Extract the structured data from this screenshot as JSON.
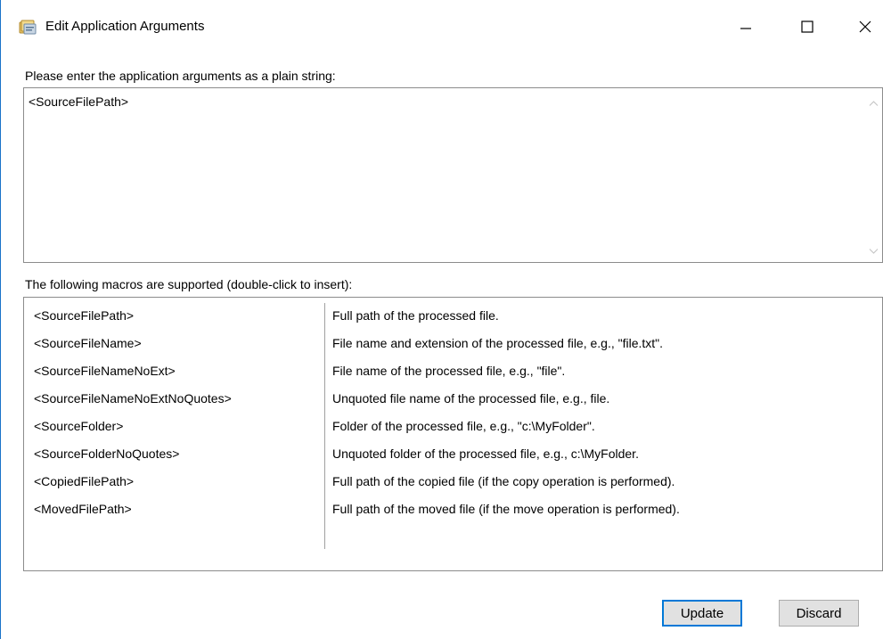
{
  "window": {
    "title": "Edit Application Arguments",
    "icon": "application-arguments-icon",
    "controls": [
      "minimize-icon",
      "maximize-icon",
      "close-icon"
    ]
  },
  "arguments": {
    "label": "Please enter the application arguments as a plain string:",
    "value": "<SourceFilePath>"
  },
  "macros": {
    "label": "The following macros are supported (double-click to insert):",
    "rows": [
      {
        "name": "<SourceFilePath>",
        "description": "Full path of the processed file."
      },
      {
        "name": "<SourceFileName>",
        "description": "File name and extension of the processed file, e.g., \"file.txt\"."
      },
      {
        "name": "<SourceFileNameNoExt>",
        "description": "File name of the processed file, e.g., \"file\"."
      },
      {
        "name": "<SourceFileNameNoExtNoQuotes>",
        "description": "Unquoted file name of the processed file, e.g., file."
      },
      {
        "name": "<SourceFolder>",
        "description": "Folder of the processed file, e.g., \"c:\\MyFolder\"."
      },
      {
        "name": "<SourceFolderNoQuotes>",
        "description": "Unquoted folder of the processed file, e.g., c:\\MyFolder."
      },
      {
        "name": "<CopiedFilePath>",
        "description": "Full path of the copied file (if the copy operation is performed)."
      },
      {
        "name": "<MovedFilePath>",
        "description": "Full path of the moved file (if the move operation is performed)."
      }
    ]
  },
  "buttons": {
    "update_label": "Update",
    "discard_label": "Discard"
  },
  "colors": {
    "accent": "#0078d7",
    "window_border": "#1a73c9",
    "button_face": "#e1e1e1"
  }
}
